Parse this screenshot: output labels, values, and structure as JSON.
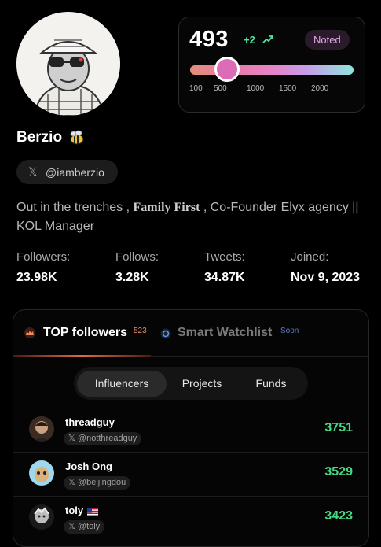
{
  "profile": {
    "name": "Berzio",
    "handle": "@iamberzio",
    "bio_part1": "Out in the trenches , ",
    "bio_serif": "Family First",
    "bio_part2": " , Co-Founder Elyx agency || KOL Manager"
  },
  "score": {
    "value": "493",
    "delta": "+2",
    "badge": "Noted",
    "scale_ticks": [
      "100",
      "500",
      "1000",
      "1500",
      "2000"
    ],
    "slider_position": 0.2
  },
  "stats": [
    {
      "label": "Followers:",
      "value": "23.98K"
    },
    {
      "label": "Follows:",
      "value": "3.28K"
    },
    {
      "label": "Tweets:",
      "value": "34.87K"
    },
    {
      "label": "Joined:",
      "value": "Nov 9, 2023"
    }
  ],
  "tabs": {
    "top_followers": "TOP followers",
    "top_followers_count": "523",
    "smart_watchlist": "Smart Watchlist",
    "soon": "Soon"
  },
  "segments": [
    "Influencers",
    "Projects",
    "Funds"
  ],
  "followers": [
    {
      "name": "threadguy",
      "handle": "@notthreadguy",
      "score": "3751"
    },
    {
      "name": "Josh Ong",
      "handle": "@beijingdou",
      "score": "3529"
    },
    {
      "name": "toly",
      "handle": "@toly",
      "score": "3423"
    }
  ],
  "colors": {
    "accent_green": "#49d886",
    "noted_badge": "#e0a6e6",
    "thumb": "#dd6bb5",
    "top_count": "#e88c66"
  }
}
